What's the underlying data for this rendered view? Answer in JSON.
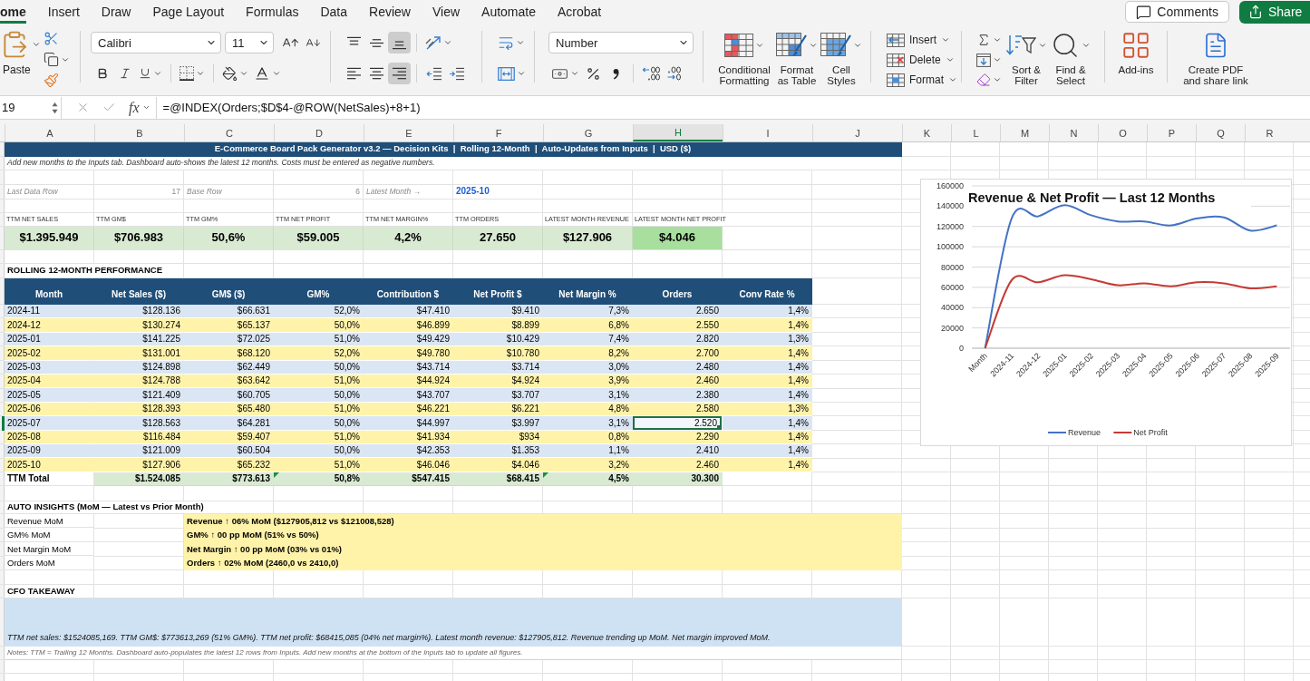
{
  "ribbon_tabs": [
    {
      "label": "ome",
      "selected": true
    },
    {
      "label": "Insert",
      "selected": false
    },
    {
      "label": "Draw",
      "selected": false
    },
    {
      "label": "Page Layout",
      "selected": false
    },
    {
      "label": "Formulas",
      "selected": false
    },
    {
      "label": "Data",
      "selected": false
    },
    {
      "label": "Review",
      "selected": false
    },
    {
      "label": "View",
      "selected": false
    },
    {
      "label": "Automate",
      "selected": false
    },
    {
      "label": "Acrobat",
      "selected": false
    }
  ],
  "header_actions": {
    "comments": "Comments",
    "share": "Share"
  },
  "ribbon": {
    "paste": "Paste",
    "font_name": "Calibri",
    "font_size": "11",
    "vertical_alignment": [
      {
        "kind": "top",
        "selected": false
      },
      {
        "kind": "middle",
        "selected": false
      },
      {
        "kind": "bottom",
        "selected": true
      }
    ],
    "horizontal_alignment": [
      {
        "kind": "left",
        "selected": false
      },
      {
        "kind": "center",
        "selected": false
      },
      {
        "kind": "right",
        "selected": true
      }
    ],
    "number_format": "Number",
    "style_buttons": [
      {
        "kind": "conditional",
        "label": "Conditional Formatting"
      },
      {
        "kind": "table",
        "label": "Format as Table"
      },
      {
        "kind": "styles",
        "label": "Cell Styles"
      }
    ],
    "cell_buttons": [
      {
        "kind": "insert",
        "label": "Insert"
      },
      {
        "kind": "delete",
        "label": "Delete"
      },
      {
        "kind": "format",
        "label": "Format"
      }
    ],
    "editing_buttons": [
      {
        "kind": "sort",
        "label": "Sort & Filter"
      },
      {
        "kind": "find",
        "label": "Find & Select"
      }
    ],
    "add_ins": "Add-ins",
    "create_pdf": "Create PDF and share link"
  },
  "formula_bar": {
    "name_box": "19",
    "function_symbol": "fx",
    "formula": "=@INDEX(Orders;$D$4-@ROW(NetSales)+8+1)"
  },
  "sheet": {
    "column_headers": [
      {
        "label": "A",
        "selected": false
      },
      {
        "label": "B",
        "selected": false
      },
      {
        "label": "C",
        "selected": false
      },
      {
        "label": "D",
        "selected": false
      },
      {
        "label": "E",
        "selected": false
      },
      {
        "label": "F",
        "selected": false
      },
      {
        "label": "G",
        "selected": false
      },
      {
        "label": "H",
        "selected": true
      },
      {
        "label": "I",
        "selected": false
      },
      {
        "label": "J",
        "selected": false
      },
      {
        "label": "K",
        "selected": false
      },
      {
        "label": "L",
        "selected": false
      },
      {
        "label": "M",
        "selected": false
      },
      {
        "label": "N",
        "selected": false
      },
      {
        "label": "O",
        "selected": false
      },
      {
        "label": "P",
        "selected": false
      },
      {
        "label": "Q",
        "selected": false
      },
      {
        "label": "R",
        "selected": false
      }
    ],
    "banner": "E-Commerce Board Pack Generator v3.2 — Decision Kits  |  Rolling 12-Month  |  Auto-Updates from Inputs  |  USD ($)",
    "note": "Add new months to the Inputs tab. Dashboard auto-shows the latest 12 months. Costs must be entered as negative numbers.",
    "parameters": [
      {
        "label": "Last Data Row",
        "value": "17",
        "highlighted": false
      },
      {
        "label": "Base Row",
        "value": "6",
        "highlighted": false
      },
      {
        "label": "Latest Month →",
        "value": "2025-10",
        "highlighted": true
      }
    ],
    "kpis": [
      {
        "label": "TTM NET SALES",
        "value": "$1.395.949",
        "highlighted": false
      },
      {
        "label": "TTM GM$",
        "value": "$706.983",
        "highlighted": false
      },
      {
        "label": "TTM GM%",
        "value": "50,6%",
        "highlighted": false
      },
      {
        "label": "TTM NET PROFIT",
        "value": "$59.005",
        "highlighted": false
      },
      {
        "label": "TTM NET MARGIN%",
        "value": "4,2%",
        "highlighted": false
      },
      {
        "label": "TTM ORDERS",
        "value": "27.650",
        "highlighted": false
      },
      {
        "label": "LATEST MONTH REVENUE",
        "value": "$127.906",
        "highlighted": false
      },
      {
        "label": "LATEST MONTH NET PROFIT",
        "value": "$4.046",
        "highlighted": true
      }
    ],
    "performance": {
      "title": "ROLLING 12-MONTH PERFORMANCE",
      "columns": [
        "Month",
        "Net Sales ($)",
        "GM$ ($)",
        "GM%",
        "Contribution $",
        "Net Profit $",
        "Net Margin %",
        "Orders",
        "Conv Rate %"
      ],
      "rows": [
        {
          "cells": [
            "2024-11",
            "$128.136",
            "$66.631",
            "52,0%",
            "$47.410",
            "$9.410",
            "7,3%",
            "2.650",
            "1,4%"
          ],
          "selected": false
        },
        {
          "cells": [
            "2024-12",
            "$130.274",
            "$65.137",
            "50,0%",
            "$46.899",
            "$8.899",
            "6,8%",
            "2.550",
            "1,4%"
          ],
          "selected": false
        },
        {
          "cells": [
            "2025-01",
            "$141.225",
            "$72.025",
            "51,0%",
            "$49.429",
            "$10.429",
            "7,4%",
            "2.820",
            "1,3%"
          ],
          "selected": false
        },
        {
          "cells": [
            "2025-02",
            "$131.001",
            "$68.120",
            "52,0%",
            "$49.780",
            "$10.780",
            "8,2%",
            "2.700",
            "1,4%"
          ],
          "selected": false
        },
        {
          "cells": [
            "2025-03",
            "$124.898",
            "$62.449",
            "50,0%",
            "$43.714",
            "$3.714",
            "3,0%",
            "2.480",
            "1,4%"
          ],
          "selected": false
        },
        {
          "cells": [
            "2025-04",
            "$124.788",
            "$63.642",
            "51,0%",
            "$44.924",
            "$4.924",
            "3,9%",
            "2.460",
            "1,4%"
          ],
          "selected": false
        },
        {
          "cells": [
            "2025-05",
            "$121.409",
            "$60.705",
            "50,0%",
            "$43.707",
            "$3.707",
            "3,1%",
            "2.380",
            "1,4%"
          ],
          "selected": false
        },
        {
          "cells": [
            "2025-06",
            "$128.393",
            "$65.480",
            "51,0%",
            "$46.221",
            "$6.221",
            "4,8%",
            "2.580",
            "1,3%"
          ],
          "selected": false
        },
        {
          "cells": [
            "2025-07",
            "$128.563",
            "$64.281",
            "50,0%",
            "$44.997",
            "$3.997",
            "3,1%",
            "2.520",
            "1,4%"
          ],
          "selected": true
        },
        {
          "cells": [
            "2025-08",
            "$116.484",
            "$59.407",
            "51,0%",
            "$41.934",
            "$934",
            "0,8%",
            "2.290",
            "1,4%"
          ],
          "selected": false
        },
        {
          "cells": [
            "2025-09",
            "$121.009",
            "$60.504",
            "50,0%",
            "$42.353",
            "$1.353",
            "1,1%",
            "2.410",
            "1,4%"
          ],
          "selected": false
        },
        {
          "cells": [
            "2025-10",
            "$127.906",
            "$65.232",
            "51,0%",
            "$46.046",
            "$4.046",
            "3,2%",
            "2.460",
            "1,4%"
          ],
          "selected": false
        }
      ],
      "total": {
        "label": "TTM Total",
        "cells": [
          {
            "text": "$1.524.085",
            "flagged": false
          },
          {
            "text": "$773.613",
            "flagged": false
          },
          {
            "text": "50,8%",
            "flagged": true
          },
          {
            "text": "$547.415",
            "flagged": false
          },
          {
            "text": "$68.415",
            "flagged": false
          },
          {
            "text": "4,5%",
            "flagged": true
          },
          {
            "text": "30.300",
            "flagged": false
          }
        ]
      }
    },
    "insights": {
      "title": "AUTO INSIGHTS (MoM — Latest vs Prior Month)",
      "items": [
        {
          "label": "Revenue MoM",
          "text": "Revenue ↑ 06% MoM ($127905,812 vs $121008,528)"
        },
        {
          "label": "GM% MoM",
          "text": "GM% ↑ 00 pp MoM (51% vs 50%)"
        },
        {
          "label": "Net Margin MoM",
          "text": "Net Margin ↑ 00 pp MoM (03% vs 01%)"
        },
        {
          "label": "Orders MoM",
          "text": "Orders ↑ 02% MoM (2460,0 vs 2410,0)"
        }
      ]
    },
    "takeaway": {
      "title": "CFO TAKEAWAY",
      "text": "TTM net sales: $1524085,169. TTM GM$: $773613,269 (51% GM%). TTM net profit: $68415,085 (04% net margin%). Latest month revenue: $127905,812. Revenue trending up MoM. Net margin improved MoM."
    },
    "notes": "Notes: TTM = Trailing 12 Months. Dashboard auto-populates the latest 12 rows from Inputs. Add new months at the bottom of the Inputs tab to update all figures."
  },
  "chart": {
    "chart_data": {
      "type": "line",
      "title": "Revenue & Net Profit — Last 12 Months",
      "categories": [
        "Month",
        "2024-11",
        "2024-12",
        "2025-01",
        "2025-02",
        "2025-03",
        "2025-04",
        "2025-05",
        "2025-06",
        "2025-07",
        "2025-08",
        "2025-09"
      ],
      "series": [
        {
          "name": "Revenue",
          "color": "#4472c4",
          "values": [
            0,
            128000,
            130000,
            141000,
            131000,
            125000,
            125000,
            121000,
            128000,
            129000,
            116000,
            121000
          ]
        },
        {
          "name": "Net Profit",
          "color": "#c43b35",
          "values": [
            0,
            67000,
            65000,
            72000,
            68000,
            62000,
            64000,
            61000,
            65000,
            64000,
            59000,
            61000
          ]
        }
      ],
      "ylim": [
        0,
        160000
      ],
      "yticks": [
        0,
        20000,
        40000,
        60000,
        80000,
        100000,
        120000,
        140000,
        160000
      ],
      "grid": true,
      "legend": "bottom"
    }
  }
}
